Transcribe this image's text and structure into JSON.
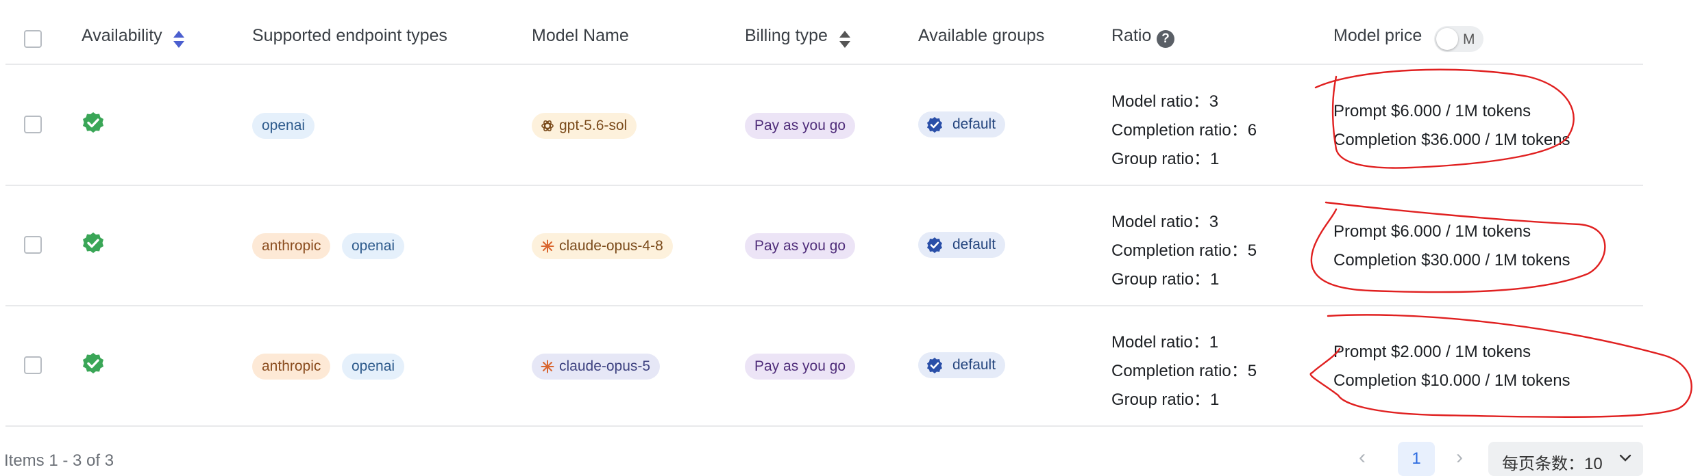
{
  "header": {
    "availability": "Availability",
    "endpoint_types": "Supported endpoint types",
    "model_name": "Model Name",
    "billing_type": "Billing type",
    "available_groups": "Available groups",
    "ratio": "Ratio",
    "ratio_help_icon": "?",
    "model_price": "Model price",
    "price_toggle_label": "M"
  },
  "rows": [
    {
      "endpoints": [
        "openai"
      ],
      "model": "gpt-5.6-sol",
      "model_icon": "openai-icon",
      "billing": "Pay as you go",
      "group": "default",
      "model_ratio": "Model ratio：3",
      "completion_ratio": "Completion ratio：6",
      "group_ratio": "Group ratio：1",
      "prompt_price": "Prompt $6.000 / 1M tokens",
      "completion_price": "Completion $36.000 / 1M tokens"
    },
    {
      "endpoints": [
        "anthropic",
        "openai"
      ],
      "model": "claude-opus-4-8",
      "model_icon": "claude-icon",
      "billing": "Pay as you go",
      "group": "default",
      "model_ratio": "Model ratio：3",
      "completion_ratio": "Completion ratio：5",
      "group_ratio": "Group ratio：1",
      "prompt_price": "Prompt $6.000 / 1M tokens",
      "completion_price": "Completion $30.000 / 1M tokens"
    },
    {
      "endpoints": [
        "anthropic",
        "openai"
      ],
      "model": "claude-opus-5",
      "model_icon": "claude-icon",
      "billing": "Pay as you go",
      "group": "default",
      "model_ratio": "Model ratio：1",
      "completion_ratio": "Completion ratio：5",
      "group_ratio": "Group ratio：1",
      "prompt_price": "Prompt $2.000 / 1M tokens",
      "completion_price": "Completion $10.000 / 1M tokens"
    }
  ],
  "footer": {
    "items_text": "Items 1 - 3 of 3",
    "current_page": "1",
    "page_size_label": "每页条数：10"
  },
  "colors": {
    "accent": "#4b5fcf",
    "available_green": "#3aa657",
    "annotation_red": "#e02020"
  }
}
